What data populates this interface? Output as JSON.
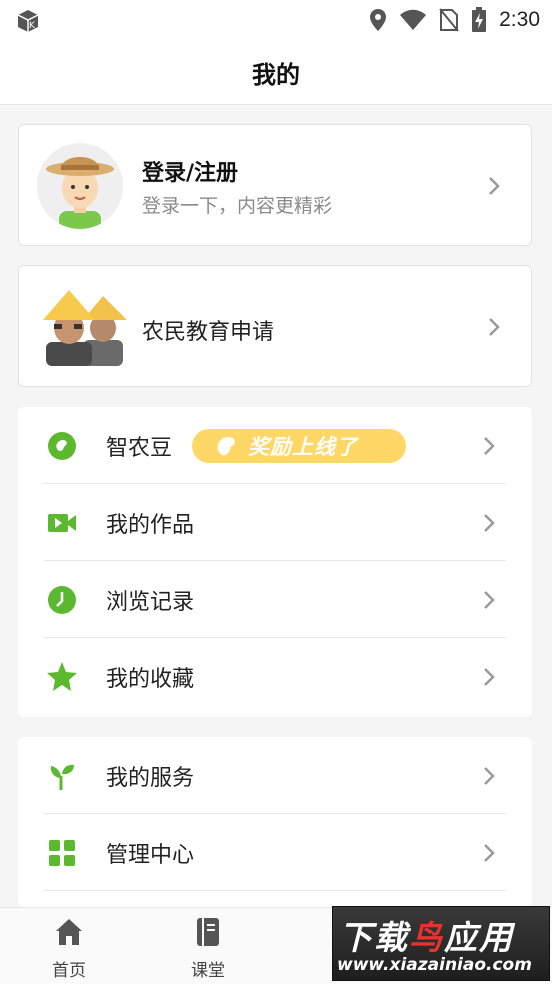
{
  "status_bar": {
    "time": "2:30"
  },
  "header": {
    "title": "我的"
  },
  "profile": {
    "name": "登录/注册",
    "subtitle": "登录一下，内容更精彩"
  },
  "apply": {
    "label": "农民教育申请"
  },
  "menu_primary": [
    {
      "label": "智农豆",
      "icon": "bean-icon",
      "badge": "奖励上线了"
    },
    {
      "label": "我的作品",
      "icon": "video-icon"
    },
    {
      "label": "浏览记录",
      "icon": "clock-icon"
    },
    {
      "label": "我的收藏",
      "icon": "star-icon"
    }
  ],
  "menu_secondary": [
    {
      "label": "我的服务",
      "icon": "sprout-icon"
    },
    {
      "label": "管理中心",
      "icon": "grid-icon"
    }
  ],
  "tabs": [
    {
      "label": "首页",
      "icon": "home-icon"
    },
    {
      "label": "课堂",
      "icon": "book-icon"
    }
  ],
  "watermark": {
    "line1_a": "下载",
    "line1_b": "鸟",
    "line1_c": "应用",
    "line2": "www.xiazainiao.com"
  },
  "colors": {
    "accent": "#5cb82f",
    "badge": "#ffd766"
  }
}
